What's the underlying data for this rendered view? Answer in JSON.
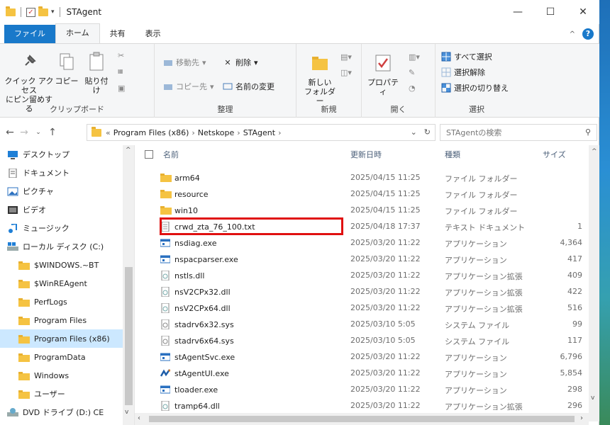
{
  "window": {
    "title": "STAgent"
  },
  "ribbon": {
    "tabs": [
      "ファイル",
      "ホーム",
      "共有",
      "表示"
    ],
    "clipboard": {
      "pin_label_1": "クイック アクセス",
      "pin_label_2": "にピン留めする",
      "copy": "コピー",
      "paste": "貼り付け",
      "group": "クリップボード"
    },
    "organize": {
      "move": "移動先",
      "delete": "削除",
      "copy_to": "コピー先",
      "rename": "名前の変更",
      "group": "整理"
    },
    "new": {
      "new_folder_1": "新しい",
      "new_folder_2": "フォルダー",
      "group": "新規"
    },
    "open": {
      "properties": "プロパティ",
      "group": "開く"
    },
    "select": {
      "select_all": "すべて選択",
      "select_none": "選択解除",
      "invert": "選択の切り替え",
      "group": "選択"
    }
  },
  "address": {
    "crumbs": [
      "Program Files (x86)",
      "Netskope",
      "STAgent"
    ],
    "prefix": "«",
    "search_placeholder": "STAgentの検索"
  },
  "nav": [
    {
      "label": "デスクトップ",
      "icon": "desktop-icon"
    },
    {
      "label": "ドキュメント",
      "icon": "documents-icon"
    },
    {
      "label": "ピクチャ",
      "icon": "pictures-icon"
    },
    {
      "label": "ビデオ",
      "icon": "videos-icon"
    },
    {
      "label": "ミュージック",
      "icon": "music-icon"
    },
    {
      "label": "ローカル ディスク (C:)",
      "icon": "drive-icon"
    },
    {
      "label": "$WINDOWS.~BT",
      "icon": "folder-icon"
    },
    {
      "label": "$WinREAgent",
      "icon": "folder-icon"
    },
    {
      "label": "PerfLogs",
      "icon": "folder-icon"
    },
    {
      "label": "Program Files",
      "icon": "folder-icon"
    },
    {
      "label": "Program Files (x86)",
      "icon": "folder-icon"
    },
    {
      "label": "ProgramData",
      "icon": "folder-icon"
    },
    {
      "label": "Windows",
      "icon": "folder-icon"
    },
    {
      "label": "ユーザー",
      "icon": "folder-icon"
    },
    {
      "label": "DVD ドライブ (D:) CE",
      "icon": "dvd-icon"
    }
  ],
  "columns": {
    "name": "名前",
    "date": "更新日時",
    "type": "種類",
    "size": "サイズ"
  },
  "files": [
    {
      "name": "arm64",
      "date": "2025/04/15 11:25",
      "type": "ファイル フォルダー",
      "size": "",
      "icon": "folder-icon"
    },
    {
      "name": "resource",
      "date": "2025/04/15 11:25",
      "type": "ファイル フォルダー",
      "size": "",
      "icon": "folder-icon"
    },
    {
      "name": "win10",
      "date": "2025/04/15 11:25",
      "type": "ファイル フォルダー",
      "size": "",
      "icon": "folder-icon"
    },
    {
      "name": "crwd_zta_76_100.txt",
      "date": "2025/04/18 17:37",
      "type": "テキスト ドキュメント",
      "size": "1",
      "icon": "text-file-icon"
    },
    {
      "name": "nsdiag.exe",
      "date": "2025/03/20 11:22",
      "type": "アプリケーション",
      "size": "4,364",
      "icon": "exe-icon"
    },
    {
      "name": "nspacparser.exe",
      "date": "2025/03/20 11:22",
      "type": "アプリケーション",
      "size": "417",
      "icon": "exe-icon"
    },
    {
      "name": "nstls.dll",
      "date": "2025/03/20 11:22",
      "type": "アプリケーション拡張",
      "size": "409",
      "icon": "dll-icon"
    },
    {
      "name": "nsV2CPx32.dll",
      "date": "2025/03/20 11:22",
      "type": "アプリケーション拡張",
      "size": "422",
      "icon": "dll-icon"
    },
    {
      "name": "nsV2CPx64.dll",
      "date": "2025/03/20 11:22",
      "type": "アプリケーション拡張",
      "size": "516",
      "icon": "dll-icon"
    },
    {
      "name": "stadrv6x32.sys",
      "date": "2025/03/10 5:05",
      "type": "システム ファイル",
      "size": "99",
      "icon": "sys-icon"
    },
    {
      "name": "stadrv6x64.sys",
      "date": "2025/03/10 5:05",
      "type": "システム ファイル",
      "size": "117",
      "icon": "sys-icon"
    },
    {
      "name": "stAgentSvc.exe",
      "date": "2025/03/20 11:22",
      "type": "アプリケーション",
      "size": "6,796",
      "icon": "exe-icon"
    },
    {
      "name": "stAgentUI.exe",
      "date": "2025/03/20 11:22",
      "type": "アプリケーション",
      "size": "5,854",
      "icon": "netskope-app-icon"
    },
    {
      "name": "tloader.exe",
      "date": "2025/03/20 11:22",
      "type": "アプリケーション",
      "size": "298",
      "icon": "exe-icon"
    },
    {
      "name": "tramp64.dll",
      "date": "2025/03/20 11:22",
      "type": "アプリケーション拡張",
      "size": "296",
      "icon": "dll-icon"
    }
  ],
  "colors": {
    "accent": "#1979ca",
    "highlight_box": "#e01010",
    "selection": "#cce8ff",
    "folder": "#f5c342"
  }
}
